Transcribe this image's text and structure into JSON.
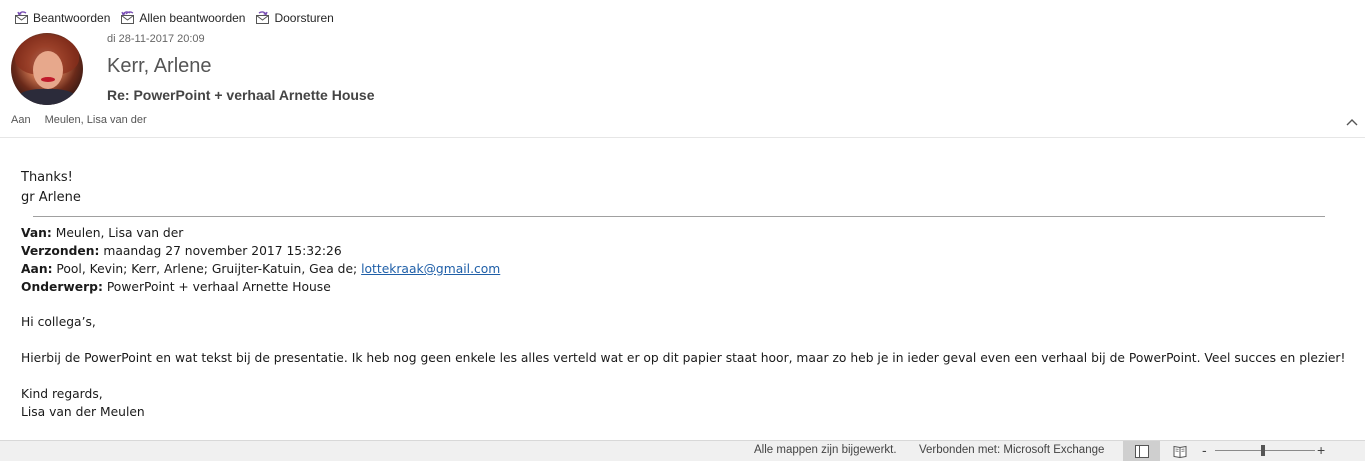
{
  "toolbar": {
    "reply_label": "Beantwoorden",
    "reply_all_label": "Allen beantwoorden",
    "forward_label": "Doorsturen"
  },
  "header": {
    "date": "di 28-11-2017 20:09",
    "sender": "Kerr, Arlene",
    "subject": "Re: PowerPoint + verhaal Arnette House",
    "to_label": "Aan",
    "to_value": "Meulen, Lisa van der"
  },
  "body": {
    "greeting_line1": "Thanks!",
    "greeting_line2": "gr Arlene",
    "from_label": "Van:",
    "from_value": " Meulen, Lisa van der",
    "sent_label": "Verzonden:",
    "sent_value": " maandag 27 november 2017 15:32:26",
    "to_label": "Aan:",
    "to_value": " Pool, Kevin; Kerr, Arlene; Gruijter-Katuin, Gea de; ",
    "to_link": "lottekraak@gmail.com",
    "subject_label": "Onderwerp:",
    "subject_value": " PowerPoint + verhaal Arnette House",
    "salutation": "Hi collega’s,",
    "message": "Hierbij de PowerPoint en wat tekst bij de presentatie. Ik heb nog geen enkele les alles verteld wat er op dit papier staat hoor, maar zo heb je in ieder geval even een verhaal bij de PowerPoint. Veel succes en plezier!",
    "closing": "Kind regards,",
    "signature": "Lisa van der Meulen"
  },
  "statusbar": {
    "sync_status": "Alle mappen zijn bijgewerkt.",
    "connection_status": "Verbonden met: Microsoft Exchange",
    "zoom_minus": "-",
    "zoom_plus": "+",
    "zoom_fraction": 0.48
  },
  "icons": {
    "reply": "reply-envelope-icon",
    "reply_all": "reply-all-envelope-icon",
    "forward": "forward-envelope-icon",
    "collapse": "chevron-up-icon",
    "normal_view": "normal-view-icon",
    "reading_view": "reading-view-icon"
  },
  "colors": {
    "link": "#1f5fa8",
    "arrow_accent": "#7a4fb5"
  }
}
